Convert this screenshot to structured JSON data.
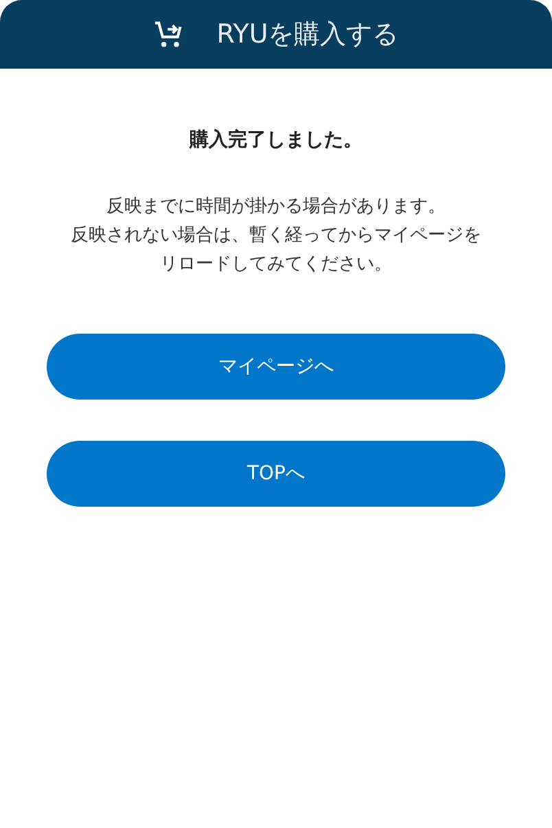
{
  "header": {
    "title": "RYUを購入する"
  },
  "heading": "購入完了しました。",
  "message_lines": [
    "反映までに時間が掛かる場合があります。",
    "反映されない場合は、暫く経ってからマイページを",
    "リロードしてみてください。"
  ],
  "buttons": [
    {
      "label": "マイページへ"
    },
    {
      "label": "TOPへ"
    }
  ]
}
